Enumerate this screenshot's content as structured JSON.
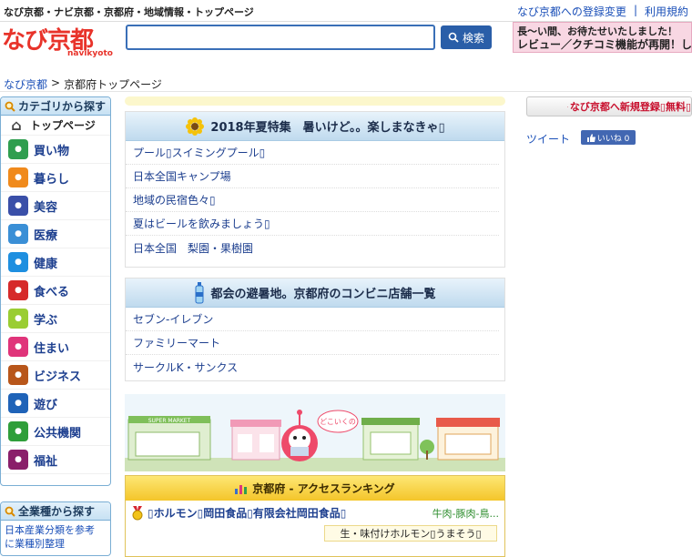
{
  "top": {
    "tagline": "なび京都・ナビ京都・京都府・地域情報・トップページ",
    "links": [
      "なび京都への登録変更",
      "利用規約"
    ],
    "separator": "|"
  },
  "header": {
    "logo_main": "なび京都",
    "logo_sub": "navikyoto",
    "search_placeholder": "",
    "search_button": "検索",
    "banner_line1": "長〜い間、お待たせいたしました！",
    "banner_line2": "レビュー／クチコミ機能が再開！しました"
  },
  "breadcrumb": {
    "home": "なび京都",
    "separator": ">",
    "current": "京都府トップページ"
  },
  "sidebar": {
    "title": "カテゴリから探す",
    "items": [
      {
        "label": "トップページ",
        "icon": "home-icon",
        "color": "#444444"
      },
      {
        "label": "買い物",
        "icon": "shopping-bag-icon",
        "color": "#2f9e4f"
      },
      {
        "label": "暮らし",
        "icon": "family-icon",
        "color": "#f08a1c"
      },
      {
        "label": "美容",
        "icon": "beauty-icon",
        "color": "#3a4fa8"
      },
      {
        "label": "医療",
        "icon": "medical-icon",
        "color": "#3a8fd6"
      },
      {
        "label": "健康",
        "icon": "fitness-icon",
        "color": "#1e8fe0"
      },
      {
        "label": "食べる",
        "icon": "food-icon",
        "color": "#d62a2a"
      },
      {
        "label": "学ぶ",
        "icon": "study-icon",
        "color": "#9acd32"
      },
      {
        "label": "住まい",
        "icon": "house-icon",
        "color": "#e0347a"
      },
      {
        "label": "ビジネス",
        "icon": "building-icon",
        "color": "#b8561a"
      },
      {
        "label": "遊び",
        "icon": "camera-icon",
        "color": "#1f63b8"
      },
      {
        "label": "公共機関",
        "icon": "public-office-icon",
        "color": "#2f9e3a"
      },
      {
        "label": "福祉",
        "icon": "welfare-icon",
        "color": "#8a1f6a"
      }
    ]
  },
  "sidebar2": {
    "title": "全業種から探す",
    "note_line1": "日本産業分類を参考",
    "note_line2": "に業種別整理"
  },
  "panel1": {
    "title": "2018年夏特集　暑いけど。。楽しまなきゃ▯",
    "icon": "sunflower-icon",
    "items": [
      "プール▯スイミングプール▯",
      "日本全国キャンプ場",
      "地域の民宿色々▯",
      "夏はビールを飲みましょう▯",
      "日本全国　梨園・果樹園"
    ]
  },
  "panel2": {
    "title": "都会の避暑地。京都府のコンビニ店舗一覧",
    "icon": "water-bottle-icon",
    "items": [
      "セブン-イレブン",
      "ファミリーマート",
      "サークルK・サンクス"
    ]
  },
  "scene": {
    "shop_sign": "SUPER MARKET",
    "bubble": "どこいくの"
  },
  "ranking": {
    "title": "京都府 - アクセスランキング",
    "row_title": "▯ホルモン▯岡田食品▯有限会社岡田食品▯",
    "row_category": "牛肉-豚肉-鳥...",
    "row_tag": "生・味付けホルモン▯うまそう▯"
  },
  "right": {
    "register": "なび京都へ新規登録▯無料▯",
    "tweet": "ツイート",
    "like": "いいね 0"
  },
  "colors": {
    "brand": "#e8332a",
    "link": "#1a4fb8",
    "search_border": "#3a6fb7"
  }
}
